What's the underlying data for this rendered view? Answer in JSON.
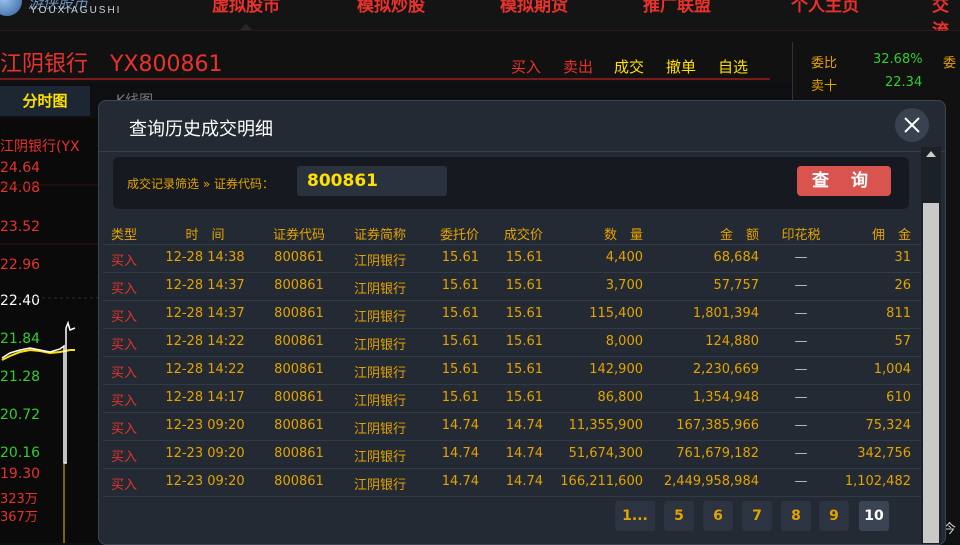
{
  "logo": {
    "cn": "游侠股市",
    "en": "YOUXIAGUSHI"
  },
  "nav": [
    "虚拟股市",
    "模拟炒股",
    "模拟期货",
    "推广联盟",
    "个人主页",
    "交流"
  ],
  "stock": {
    "name": "江阴银行",
    "code": "YX800861"
  },
  "actions": {
    "buy": "买入",
    "sell": "卖出",
    "deal": "成交",
    "cancel": "撤单",
    "watch": "自选"
  },
  "tabs": {
    "timeshare": "分时图",
    "kline": "K线图"
  },
  "chart": {
    "label": "江阴银行(YX",
    "prices": [
      "24.64",
      "24.08",
      "23.52",
      "22.96",
      "22.40",
      "21.84",
      "21.28",
      "20.72",
      "20.16",
      "19.30"
    ],
    "volumes": [
      "323万",
      "367万"
    ]
  },
  "rightpanel": {
    "ratio_label": "委比",
    "ratio_value": "32.68%",
    "ratio_label2": "委",
    "sell10_label": "卖十",
    "sell10_value": "22.34",
    "bottom_label": "今"
  },
  "modal": {
    "title": "查询历史成交明细",
    "filter_label": "成交记录筛选 » 证券代码：",
    "code_value": "800861",
    "query_label": "查 询",
    "columns": [
      "类型",
      "时　间",
      "证券代码",
      "证券简称",
      "委托价",
      "成交价",
      "数　量",
      "金　额",
      "印花税",
      "佣　金"
    ],
    "rows": [
      [
        "买入",
        "12-28 14:38",
        "800861",
        "江阴银行",
        "15.61",
        "15.61",
        "4,400",
        "68,684",
        "—",
        "31"
      ],
      [
        "买入",
        "12-28 14:37",
        "800861",
        "江阴银行",
        "15.61",
        "15.61",
        "3,700",
        "57,757",
        "—",
        "26"
      ],
      [
        "买入",
        "12-28 14:37",
        "800861",
        "江阴银行",
        "15.61",
        "15.61",
        "115,400",
        "1,801,394",
        "—",
        "811"
      ],
      [
        "买入",
        "12-28 14:22",
        "800861",
        "江阴银行",
        "15.61",
        "15.61",
        "8,000",
        "124,880",
        "—",
        "57"
      ],
      [
        "买入",
        "12-28 14:22",
        "800861",
        "江阴银行",
        "15.61",
        "15.61",
        "142,900",
        "2,230,669",
        "—",
        "1,004"
      ],
      [
        "买入",
        "12-28 14:17",
        "800861",
        "江阴银行",
        "15.61",
        "15.61",
        "86,800",
        "1,354,948",
        "—",
        "610"
      ],
      [
        "买入",
        "12-23 09:20",
        "800861",
        "江阴银行",
        "14.74",
        "14.74",
        "11,355,900",
        "167,385,966",
        "—",
        "75,324"
      ],
      [
        "买入",
        "12-23 09:20",
        "800861",
        "江阴银行",
        "14.74",
        "14.74",
        "51,674,300",
        "761,679,182",
        "—",
        "342,756"
      ],
      [
        "买入",
        "12-23 09:20",
        "800861",
        "江阴银行",
        "14.74",
        "14.74",
        "166,211,600",
        "2,449,958,984",
        "—",
        "1,102,482"
      ]
    ],
    "pages": [
      "1...",
      "5",
      "6",
      "7",
      "8",
      "9",
      "10"
    ],
    "current_page": "10"
  },
  "colors": {
    "red": "#e8322c",
    "yellow": "#ffe000",
    "orange": "#e3a300",
    "green": "#33cc33"
  }
}
